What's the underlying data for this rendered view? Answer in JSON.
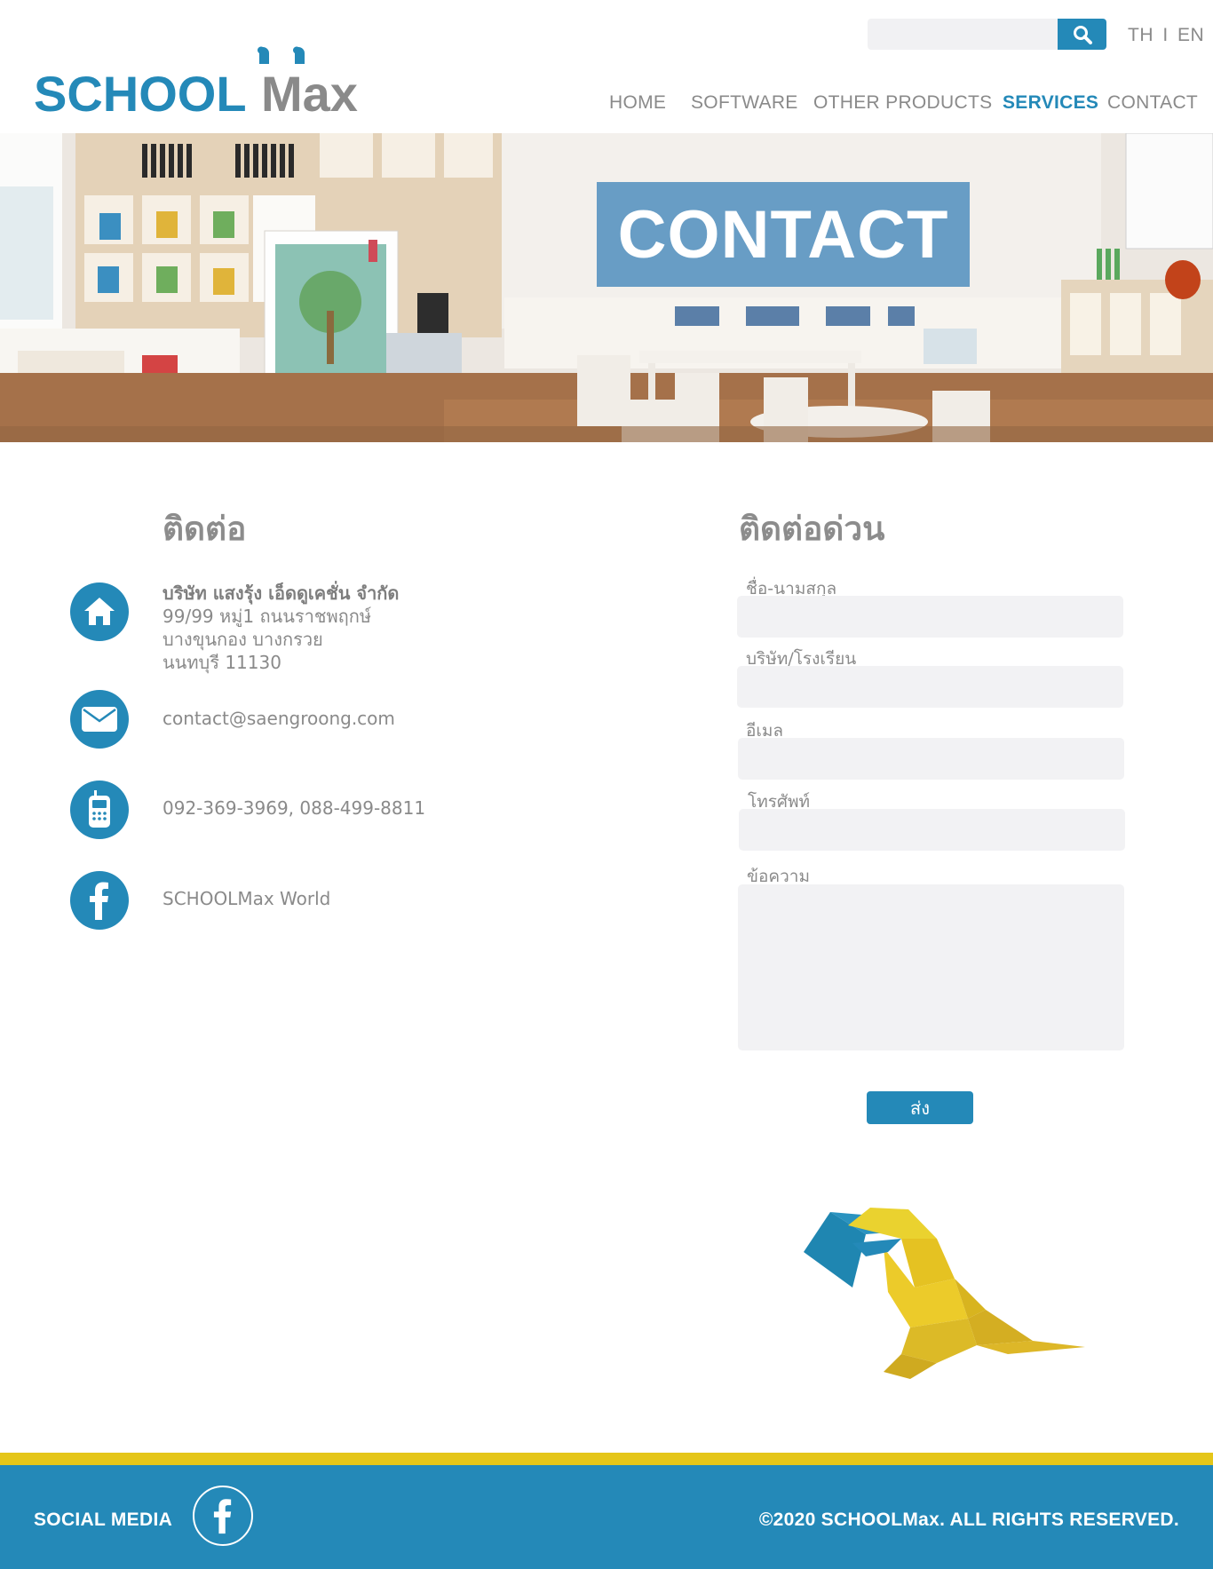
{
  "brand": {
    "logo_text_blue": "SCHOOL",
    "logo_text_gray": "Max",
    "primary_color": "#2489b8",
    "accent_color": "#e5c619",
    "text_gray": "#8a8a8a"
  },
  "header": {
    "search": {
      "placeholder": "",
      "button_icon": "search-icon"
    },
    "lang": {
      "th": "TH",
      "separator": "I",
      "en": "EN"
    },
    "nav": [
      {
        "label": "HOME",
        "active": false
      },
      {
        "label": "SOFTWARE",
        "active": false
      },
      {
        "label": "OTHER PRODUCTS",
        "active": false
      },
      {
        "label": "SERVICES",
        "active": true
      },
      {
        "label": "CONTACT",
        "active": false
      }
    ]
  },
  "hero": {
    "title": "CONTACT"
  },
  "contact": {
    "title": "ติดต่อ",
    "company": "บริษัท แสงรุ้ง เอ็ดดูเคชั่น จำกัด",
    "address_line1": "99/99 หมู่1 ถนนราชพฤกษ์",
    "address_line2": "บางขุนกอง บางกรวย",
    "address_line3": "นนทบุรี 11130",
    "email": "contact@saengroong.com",
    "phone": "092-369-3969, 088-499-8811",
    "facebook": "SCHOOLMax World",
    "icons": [
      "home-icon",
      "mail-icon",
      "phone-icon",
      "facebook-icon"
    ]
  },
  "quick_contact": {
    "title": "ติดต่อด่วน",
    "fields": {
      "name": {
        "label": "ชื่อ-นามสกุล",
        "value": ""
      },
      "company": {
        "label": "บริษัท/โรงเรียน",
        "value": ""
      },
      "email": {
        "label": "อีเมล",
        "value": ""
      },
      "phone": {
        "label": "โทรศัพท์",
        "value": ""
      },
      "message": {
        "label": "ข้อความ",
        "value": ""
      }
    },
    "submit_label": "ส่ง"
  },
  "footer": {
    "social_label": "SOCIAL MEDIA",
    "social_icon": "facebook-icon",
    "copyright": "©2020 SCHOOLMax. ALL RIGHTS RESERVED."
  }
}
